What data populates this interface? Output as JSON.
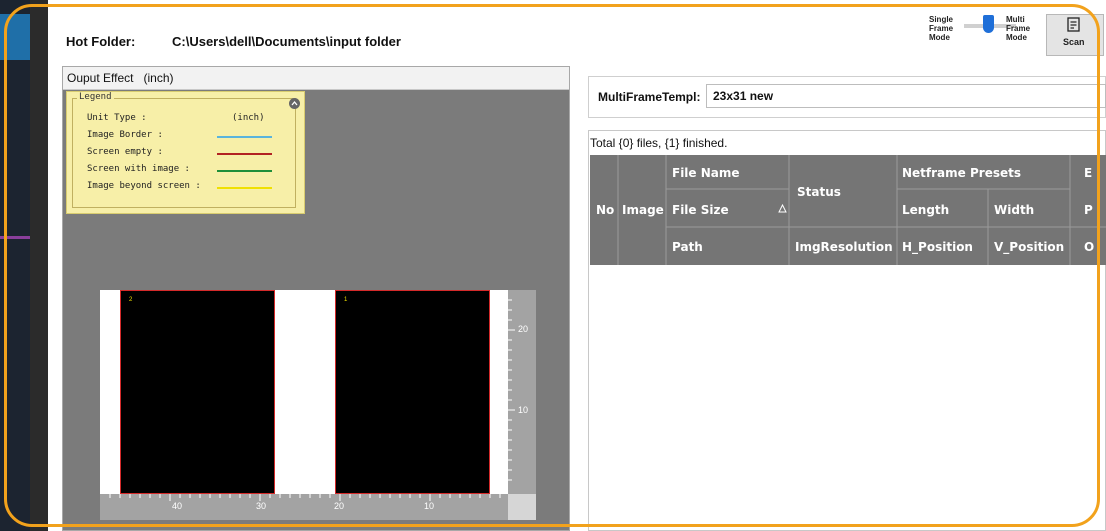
{
  "header": {
    "hot_folder_label": "Hot Folder:",
    "hot_folder_path": "C:\\Users\\dell\\Documents\\input folder"
  },
  "mode_switch": {
    "single_label": "Single\nFrame\nMode",
    "multi_label": "Multi\nFrame\nMode",
    "selected": "Multi Frame Mode"
  },
  "scan": {
    "label": "Scan",
    "icon": "scan-icon"
  },
  "output_panel": {
    "title": "Ouput Effect   (inch)",
    "legend": {
      "title": "Legend",
      "unit_type_label": "Unit Type :",
      "unit_type_value": "(inch)",
      "rows": [
        {
          "label": "Image Border :",
          "color": "#5ab4dc"
        },
        {
          "label": "Screen empty :",
          "color": "#b22222"
        },
        {
          "label": "Screen with image :",
          "color": "#1f8f3a"
        },
        {
          "label": "Image beyond screen :",
          "color": "#f0e000"
        }
      ]
    },
    "frames": [
      {
        "label": "2"
      },
      {
        "label": "1"
      }
    ],
    "vertical_ticks": [
      "20",
      "10"
    ],
    "horizontal_ticks": [
      "40",
      "30",
      "20",
      "10"
    ]
  },
  "template": {
    "label": "MultiFrameTempl:",
    "value": "23x31 new"
  },
  "files": {
    "summary": "Total {0} files, {1} finished.",
    "columns": {
      "no": "No",
      "image": "Image",
      "file_name": "File Name",
      "file_size": "File Size",
      "path": "Path",
      "status": "Status",
      "img_resolution": "ImgResolution",
      "netframe_presets": "Netframe Presets",
      "length": "Length",
      "width": "Width",
      "h_position": "H_Position",
      "v_position": "V_Position",
      "e_cut": "E",
      "p_cut": "P",
      "o_cut": "O",
      "sort_icon": "sort-ascending-icon"
    }
  },
  "colors": {
    "accent_border": "#f2a21c",
    "table_header": "#757575",
    "panel_gray": "#7a7a7a",
    "legend_bg": "#f7efa8"
  }
}
